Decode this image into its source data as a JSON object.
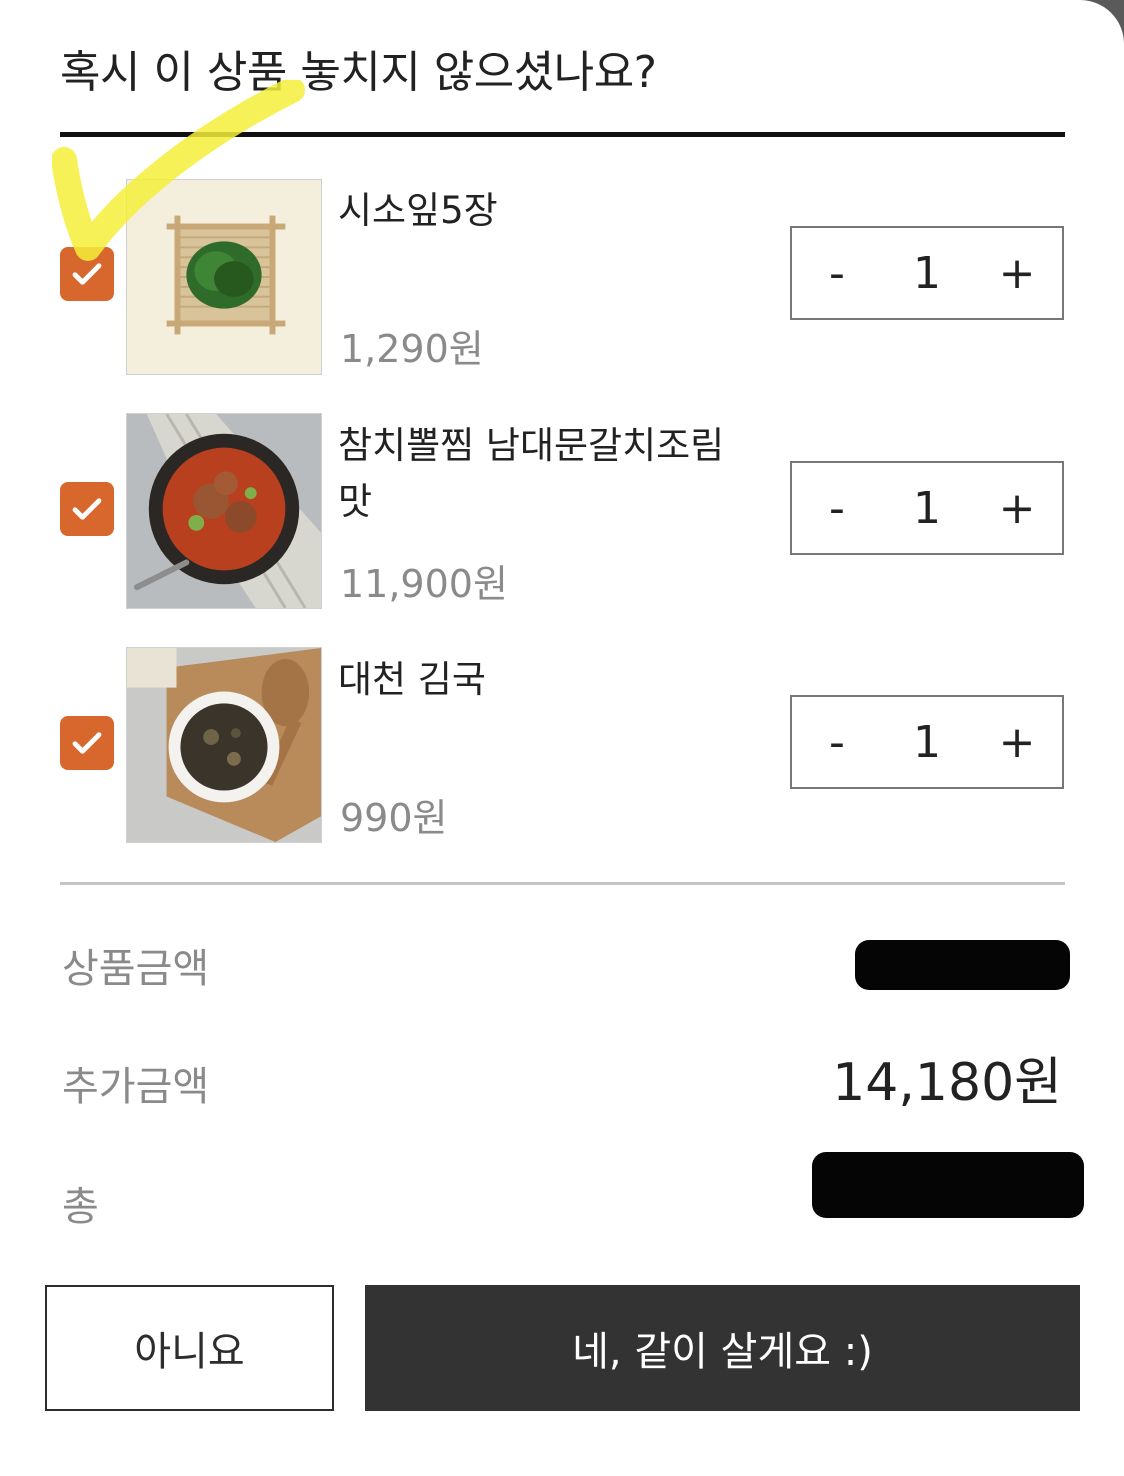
{
  "dialog": {
    "title": "혹시 이 상품 놓치지 않으셨나요?"
  },
  "items": [
    {
      "name": "시소잎5장",
      "price": "1,290원",
      "checked": true,
      "quantity": "1",
      "minus": "-",
      "plus": "+"
    },
    {
      "name": "참치뽈찜 남대문갈치조림맛",
      "price": "11,900원",
      "checked": true,
      "quantity": "1",
      "minus": "-",
      "plus": "+"
    },
    {
      "name": "대천 김국",
      "price": "990원",
      "checked": true,
      "quantity": "1",
      "minus": "-",
      "plus": "+"
    }
  ],
  "summary": {
    "product_amount_label": "상품금액",
    "extra_amount_label": "추가금액",
    "extra_amount_value": "14,180원",
    "total_label": "총"
  },
  "actions": {
    "no_label": "아니요",
    "yes_label": "네, 같이 살게요 :)"
  },
  "colors": {
    "checkbox": "#d8672d",
    "primary_button": "#333333",
    "highlight_scribble": "#f3ef3a"
  }
}
